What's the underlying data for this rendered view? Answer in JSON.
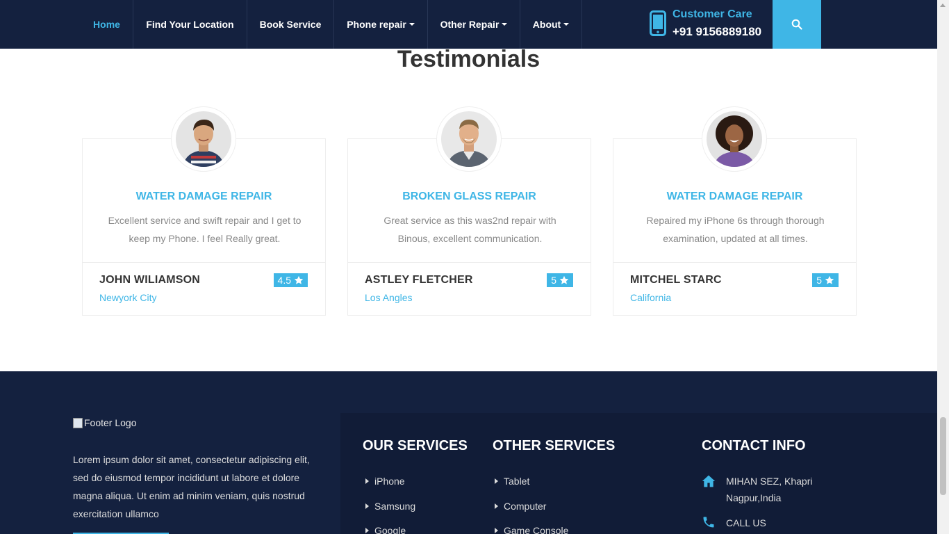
{
  "nav": {
    "items": [
      {
        "label": "Home",
        "active": true,
        "dropdown": false
      },
      {
        "label": "Find Your Location",
        "dropdown": false
      },
      {
        "label": "Book Service",
        "dropdown": false
      },
      {
        "label": "Phone repair",
        "dropdown": true
      },
      {
        "label": "Other Repair",
        "dropdown": true
      },
      {
        "label": "About",
        "dropdown": true
      }
    ],
    "customer_care_label": "Customer Care",
    "customer_care_phone": "+91 9156889180",
    "search_icon": "search-icon"
  },
  "testimonials": {
    "title": "Testimonials",
    "cards": [
      {
        "service": "WATER DAMAGE REPAIR",
        "text": "Excellent service and swift repair and I get to keep my Phone. I feel Really great.",
        "name": "JOHN WILIAMSON",
        "location": "Newyork City",
        "rating": "4.5"
      },
      {
        "service": "BROKEN GLASS REPAIR",
        "text": "Great service as this was2nd repair with Binous, excellent communication.",
        "name": "ASTLEY FLETCHER",
        "location": "Los Angles",
        "rating": "5"
      },
      {
        "service": "WATER DAMAGE REPAIR",
        "text": "Repaired my iPhone 6s through thorough examination, updated at all times.",
        "name": "MITCHEL STARC",
        "location": "California",
        "rating": "5"
      }
    ]
  },
  "footer": {
    "logo_alt": "Footer Logo",
    "description": "Lorem ipsum dolor sit amet, consectetur adipiscing elit, sed do eiusmod tempor incididunt ut labore et dolore magna aliqua. Ut enim ad minim veniam, quis nostrud exercitation ullamco",
    "our_services": {
      "title": "OUR SERVICES",
      "links": [
        "iPhone",
        "Samsung",
        "Google"
      ]
    },
    "other_services": {
      "title": "OTHER SERVICES",
      "links": [
        "Tablet",
        "Computer",
        "Game Console"
      ]
    },
    "contact": {
      "title": "CONTACT INFO",
      "address_line1": "MIHAN SEZ, Khapri",
      "address_line2": "Nagpur,India",
      "call_label": "CALL US"
    }
  },
  "colors": {
    "navy": "#14213f",
    "accent": "#3fb6e6"
  }
}
